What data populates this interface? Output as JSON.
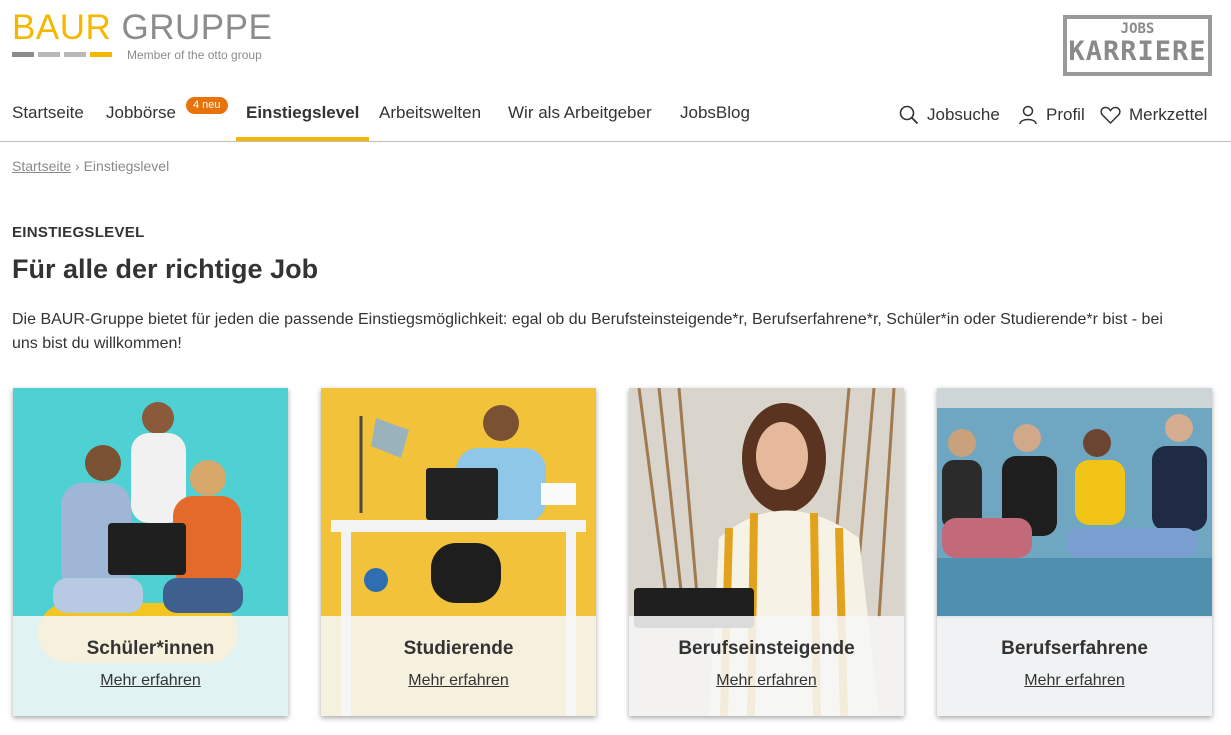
{
  "logo": {
    "brand_primary": "BAUR",
    "brand_secondary": "GRUPPE",
    "tagline": "Member of the otto group",
    "colors": {
      "yellow": "#f5b800",
      "grey": "#8c8c8c",
      "light_grey": "#b8b8b8"
    }
  },
  "stamp": {
    "line1": "JOBS",
    "line2": "KARRIERE"
  },
  "nav": {
    "items": [
      {
        "label": "Startseite"
      },
      {
        "label": "Jobbörse",
        "badge": "4 neu"
      },
      {
        "label": "Einstiegslevel"
      },
      {
        "label": "Arbeitswelten"
      },
      {
        "label": "Wir als Arbeitgeber"
      },
      {
        "label": "JobsBlog"
      }
    ],
    "right": {
      "search": "Jobsuche",
      "profile": "Profil",
      "favorites": "Merkzettel"
    },
    "accent": "#f5b800",
    "badge_color": "#e8730c"
  },
  "breadcrumb": {
    "home": "Startseite",
    "separator": "›",
    "current": "Einstiegslevel"
  },
  "main": {
    "eyebrow": "EINSTIEGSLEVEL",
    "headline": "Für alle der richtige Job",
    "intro": "Die BAUR-Gruppe bietet für jeden die passende Einstiegsmöglichkeit: egal ob du Berufsteinsteigende*r, Berufserfahrene*r, Schüler*in oder Studierende*r bist - bei uns bist du willkommen!"
  },
  "cards": [
    {
      "title": "Schüler*innen",
      "link": "Mehr erfahren",
      "image": "students-with-laptop-photo"
    },
    {
      "title": "Studierende",
      "link": "Mehr erfahren",
      "image": "student-at-desk-photo"
    },
    {
      "title": "Berufseinsteigende",
      "link": "Mehr erfahren",
      "image": "young-woman-laptop-photo"
    },
    {
      "title": "Berufserfahrene",
      "link": "Mehr erfahren",
      "image": "team-on-sofa-photo"
    }
  ]
}
